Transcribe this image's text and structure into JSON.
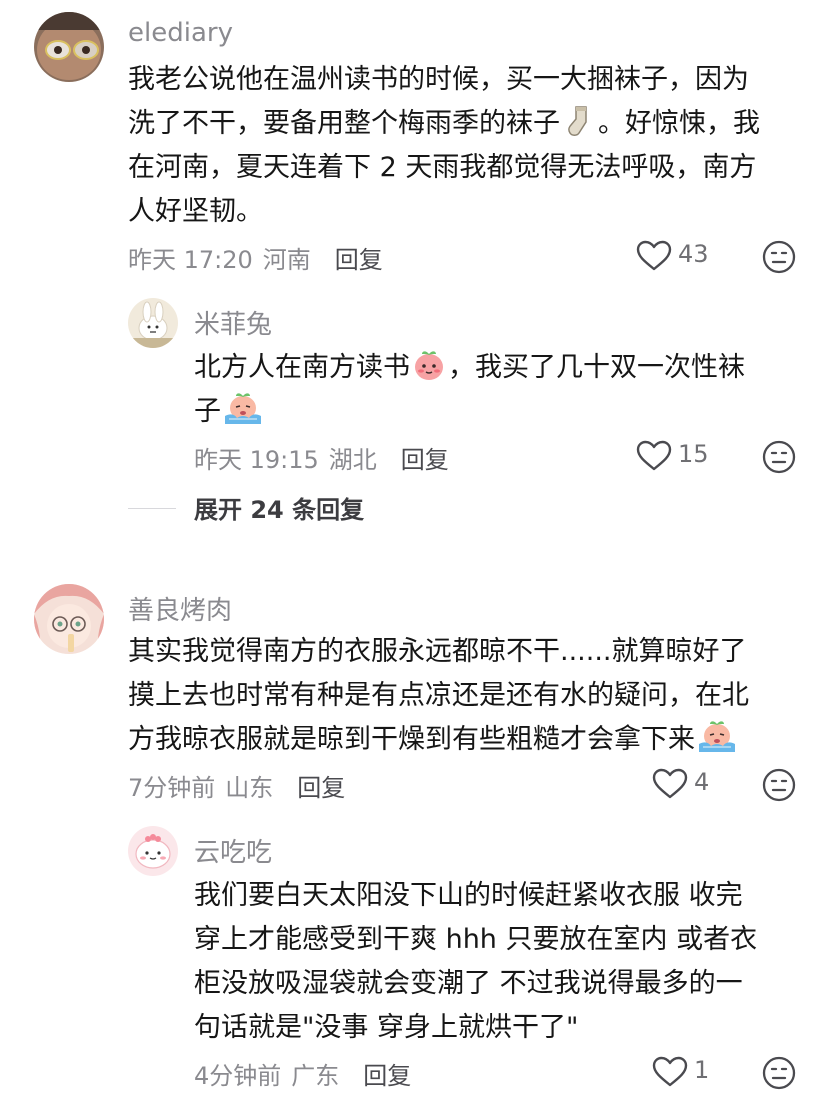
{
  "comments": [
    {
      "username": "elediary",
      "text_1": "我老公说他在温州读书的时候，买一大捆袜子，因为",
      "text_2a": "洗了不干，要备用整个梅雨季的袜子",
      "text_2b": "。好惊悚，我",
      "text_3": "在河南，夏天连着下 2 天雨我都觉得无法呼吸，南方",
      "text_4": "人好坚韧。",
      "time": "昨天 17:20",
      "location": "河南",
      "reply_label": "回复",
      "likes": "43",
      "replies": [
        {
          "username": "米菲兔",
          "text_1a": "北方人在南方读书",
          "text_1b": "，我买了几十双一次性袜",
          "text_2": "子",
          "time": "昨天 19:15",
          "location": "湖北",
          "reply_label": "回复",
          "likes": "15"
        }
      ],
      "expand_label": "展开 24 条回复"
    },
    {
      "username": "善良烤肉",
      "text_1": "其实我觉得南方的衣服永远都晾不干......就算晾好了",
      "text_2": "摸上去也时常有种是有点凉还是还有水的疑问，在北",
      "text_3": "方我晾衣服就是晾到干燥到有些粗糙才会拿下来",
      "time": "7分钟前",
      "location": "山东",
      "reply_label": "回复",
      "likes": "4",
      "replies": [
        {
          "username": "云吃吃",
          "text_1": "我们要白天太阳没下山的时候赶紧收衣服 收完",
          "text_2": "穿上才能感受到干爽 hhh 只要放在室内 或者衣",
          "text_3": "柜没放吸湿袋就会变潮了 不过我说得最多的一",
          "text_4": "句话就是\"没事 穿身上就烘干了\"",
          "time": "4分钟前",
          "location": "广东",
          "reply_label": "回复",
          "likes": "1"
        }
      ]
    }
  ],
  "icons": {
    "like": "heart-outline-icon",
    "dislike": "neutral-face-icon",
    "sock": "sock-emoji",
    "blush": "blushing-peach-emoji",
    "crying": "crying-peach-emoji"
  },
  "colors": {
    "username": "#8a8a8f",
    "text": "#161616",
    "meta": "#8a8a8f",
    "icon": "#4a4a4f"
  }
}
